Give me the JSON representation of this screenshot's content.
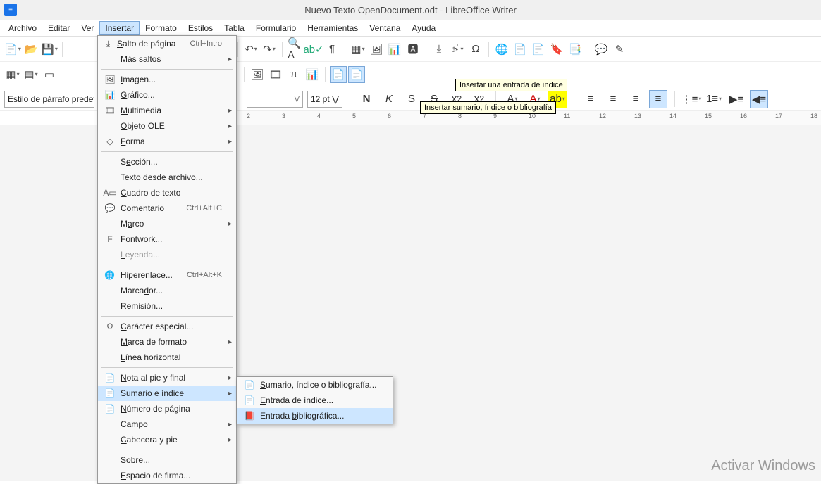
{
  "titlebar": {
    "title": "Nuevo Texto OpenDocument.odt - LibreOffice Writer"
  },
  "menubar": {
    "items": [
      "Archivo",
      "Editar",
      "Ver",
      "Insertar",
      "Formato",
      "Estilos",
      "Tabla",
      "Formulario",
      "Herramientas",
      "Ventana",
      "Ayuda"
    ],
    "active_index": 3
  },
  "style_row": {
    "paragraph_style": "Estilo de párrafo predete",
    "font_name": "",
    "font_size": "12 pt"
  },
  "formatting": {
    "bold": "N",
    "italic": "K",
    "underline": "S",
    "strike": "S",
    "super": "x²",
    "sub": "x₂",
    "caseA": "A",
    "effects": "A",
    "highlight": "ab"
  },
  "ruler_ticks": [
    "2",
    "3",
    "4",
    "5",
    "6",
    "7",
    "8",
    "9",
    "10",
    "11",
    "12",
    "13",
    "14",
    "15",
    "16",
    "17",
    "18"
  ],
  "tooltips": {
    "t1": "Insertar una entrada de índice",
    "t2": "Insertar sumario, índice o bibliografía"
  },
  "insert_menu": [
    {
      "icon": "page-break-icon",
      "label": "Salto de página",
      "accel": "Ctrl+Intro"
    },
    {
      "icon": "",
      "label": "Más saltos",
      "sub": true
    },
    {
      "sep": true
    },
    {
      "icon": "image-icon",
      "label": "Imagen..."
    },
    {
      "icon": "chart-icon",
      "label": "Gráfico..."
    },
    {
      "icon": "media-icon",
      "label": "Multimedia",
      "sub": true
    },
    {
      "icon": "",
      "label": "Objeto OLE",
      "sub": true
    },
    {
      "icon": "shape-icon",
      "label": "Forma",
      "sub": true
    },
    {
      "sep": true
    },
    {
      "icon": "",
      "label": "Sección..."
    },
    {
      "icon": "",
      "label": "Texto desde archivo..."
    },
    {
      "icon": "textbox-icon",
      "label": "Cuadro de texto"
    },
    {
      "icon": "comment-icon",
      "label": "Comentario",
      "accel": "Ctrl+Alt+C"
    },
    {
      "icon": "",
      "label": "Marco",
      "sub": true
    },
    {
      "icon": "fontwork-icon",
      "label": "Fontwork..."
    },
    {
      "icon": "",
      "label": "Leyenda...",
      "disabled": true
    },
    {
      "sep": true
    },
    {
      "icon": "hyperlink-icon",
      "label": "Hiperenlace...",
      "accel": "Ctrl+Alt+K"
    },
    {
      "icon": "",
      "label": "Marcador..."
    },
    {
      "icon": "",
      "label": "Remisión..."
    },
    {
      "sep": true
    },
    {
      "icon": "omega-icon",
      "label": "Carácter especial..."
    },
    {
      "icon": "",
      "label": "Marca de formato",
      "sub": true
    },
    {
      "icon": "",
      "label": "Línea horizontal"
    },
    {
      "sep": true
    },
    {
      "icon": "footnote-icon",
      "label": "Nota al pie y final",
      "sub": true
    },
    {
      "icon": "toc-icon",
      "label": "Sumario e índice",
      "sub": true,
      "highlight": true
    },
    {
      "icon": "pagenum-icon",
      "label": "Número de página"
    },
    {
      "icon": "",
      "label": "Campo",
      "sub": true
    },
    {
      "icon": "",
      "label": "Cabecera y pie",
      "sub": true
    },
    {
      "sep": true
    },
    {
      "icon": "",
      "label": "Sobre..."
    },
    {
      "icon": "",
      "label": "Espacio de firma..."
    }
  ],
  "toc_submenu": [
    {
      "icon": "toc-dialog-icon",
      "label": "Sumario, índice o bibliografía..."
    },
    {
      "icon": "index-entry-icon",
      "label": "Entrada de índice..."
    },
    {
      "icon": "bib-entry-icon",
      "label": "Entrada bibliográfica...",
      "highlight": true
    }
  ],
  "watermark": "Activar Windows"
}
